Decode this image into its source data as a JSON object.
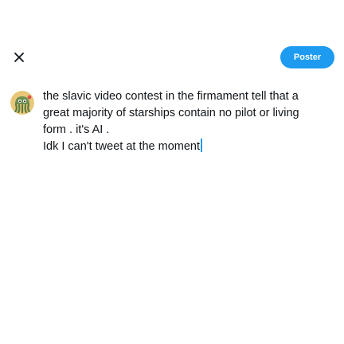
{
  "header": {
    "close_icon": "close-icon",
    "post_button_label": "Poster"
  },
  "colors": {
    "accent": "#1d9bf0",
    "text": "#0f1419",
    "background": "#ffffff"
  },
  "composer": {
    "avatar_icon": "octopus-avatar",
    "lines": [
      "the slavic video contest in the firmament tell that a",
      "great majority of starships contain no pilot or living",
      "form . it's AI .",
      "Idk I can't tweet at the moment"
    ]
  }
}
